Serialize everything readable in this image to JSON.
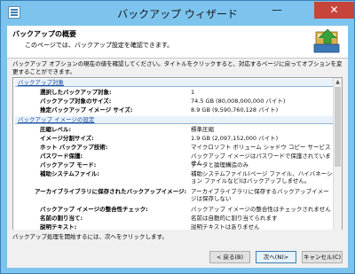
{
  "window": {
    "title": "バックアップ ウィザード",
    "minimize_glyph": "—",
    "close_glyph": "✕"
  },
  "header": {
    "title": "バックアップの概要",
    "subtitle": "このページでは、バックアップ設定を確認できます。"
  },
  "instructions": "バックアップ オプションの現在の値を確認してください。タイトルをクリックすると、対応するページに戻ってオプションを変更することができます。",
  "sections": [
    {
      "title": "バックアップ対象",
      "rows": [
        {
          "label": "選択したバックアップ対象:",
          "value": "1"
        },
        {
          "label": "バックアップ対象のサイズ:",
          "value": "74.5 GB (80,008,000,000 バイト)"
        },
        {
          "label": "推定バックアップ イメージ サイズ:",
          "value": "8.9 GB (9,590,760,128 バイト)"
        }
      ]
    },
    {
      "title": "バックアップ イメージの設定",
      "rows": [
        {
          "label": "圧縮レベル:",
          "value": "標準圧縮"
        },
        {
          "label": "イメージ分割サイズ:",
          "value": "1.9 GB (2,097,152,000 バイト)"
        },
        {
          "label": "ホット バックアップ技術:",
          "value": "マイクロソフト ボリューム シャドウ コピー サービス"
        },
        {
          "label": "パスワード保護:",
          "value": "バックアップ イメージはパスワードで保護されていません"
        },
        {
          "label": "バックアップ モード:",
          "value": "データと論理構造のみ"
        },
        {
          "label": "補助システムファイル:",
          "value": "補助システムファイル(ページ ファイル、ハイバネーション ファイルなど)はバックアップしません。"
        },
        {
          "label": "アーカイブライブラリに保存されたバックアップイメージ:",
          "value": "アーカイブライブラリに保存するバックアップイメージは保存しない"
        },
        {
          "label": "バックアップ イメージの整合性チェック:",
          "value": "バックアップ イメージの整合性はチェックされません"
        },
        {
          "label": "名前の割り当て:",
          "value": "名前は自動的に割り当てられます"
        },
        {
          "label": "説明テキスト:",
          "value": "説明テキストはありません"
        }
      ]
    }
  ],
  "footer": {
    "text": "バックアップ処理を開始するには、次へをクリックします。",
    "back_label": "< 戻る(B)",
    "next_label": "次へ(N)>",
    "cancel_label": "キャンセル(C)"
  },
  "icons": {
    "scroll_up": "▲",
    "scroll_down": "▼"
  },
  "colors": {
    "titlebar": "#7cc4ee",
    "close_button": "#c7443a",
    "link": "#1f4fa0"
  }
}
